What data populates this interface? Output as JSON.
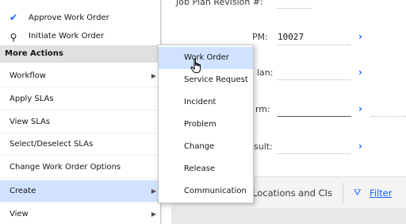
{
  "form": {
    "job_plan_revision_label": "Job Plan Revision #:",
    "pm_label": "PM:",
    "pm_value": "10027",
    "plan_label": "lan:",
    "form_label": "rm:",
    "result_label": "sult:"
  },
  "tabs": {
    "locations_label": "Locations and CIs",
    "filter_label": "Filter"
  },
  "left_menu": {
    "approve_work_order": "Approve Work Order",
    "initiate_work_order": "Initiate Work Order",
    "section_title": "More Actions",
    "items": [
      {
        "label": "Workflow",
        "has_submenu": true
      },
      {
        "label": "Apply SLAs",
        "has_submenu": false
      },
      {
        "label": "View SLAs",
        "has_submenu": false
      },
      {
        "label": "Select/Deselect SLAs",
        "has_submenu": false
      },
      {
        "label": "Change Work Order Options",
        "has_submenu": false
      },
      {
        "label": "Create",
        "has_submenu": true,
        "selected": true
      },
      {
        "label": "View",
        "has_submenu": true
      }
    ]
  },
  "create_submenu": {
    "items": [
      {
        "label": "Work Order",
        "hover": true
      },
      {
        "label": "Service Request"
      },
      {
        "label": "Incident"
      },
      {
        "label": "Problem"
      },
      {
        "label": "Change"
      },
      {
        "label": "Release"
      },
      {
        "label": "Communication"
      }
    ]
  },
  "colors": {
    "accent": "#0f62fe",
    "selected_bg": "#d0e2ff",
    "section_bg": "#e0e0e0"
  }
}
